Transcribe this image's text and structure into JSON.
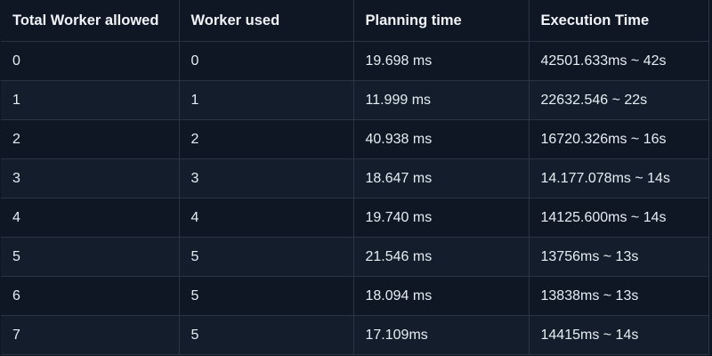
{
  "table": {
    "headers": [
      "Total Worker allowed",
      "Worker used",
      "Planning time",
      "Execution Time"
    ],
    "rows": [
      [
        "0",
        "0",
        "19.698 ms",
        "42501.633ms ~ 42s"
      ],
      [
        "1",
        "1",
        "11.999 ms",
        "22632.546 ~ 22s"
      ],
      [
        "2",
        "2",
        "40.938 ms",
        "16720.326ms ~ 16s"
      ],
      [
        "3",
        "3",
        "18.647 ms",
        "14.177.078ms ~ 14s"
      ],
      [
        "4",
        "4",
        "19.740 ms",
        "14125.600ms ~ 14s"
      ],
      [
        "5",
        "5",
        "21.546 ms",
        "13756ms ~ 13s"
      ],
      [
        "6",
        "5",
        "18.094 ms",
        "13838ms ~ 13s"
      ],
      [
        "7",
        "5",
        "17.109ms",
        "14415ms ~ 14s"
      ]
    ]
  }
}
